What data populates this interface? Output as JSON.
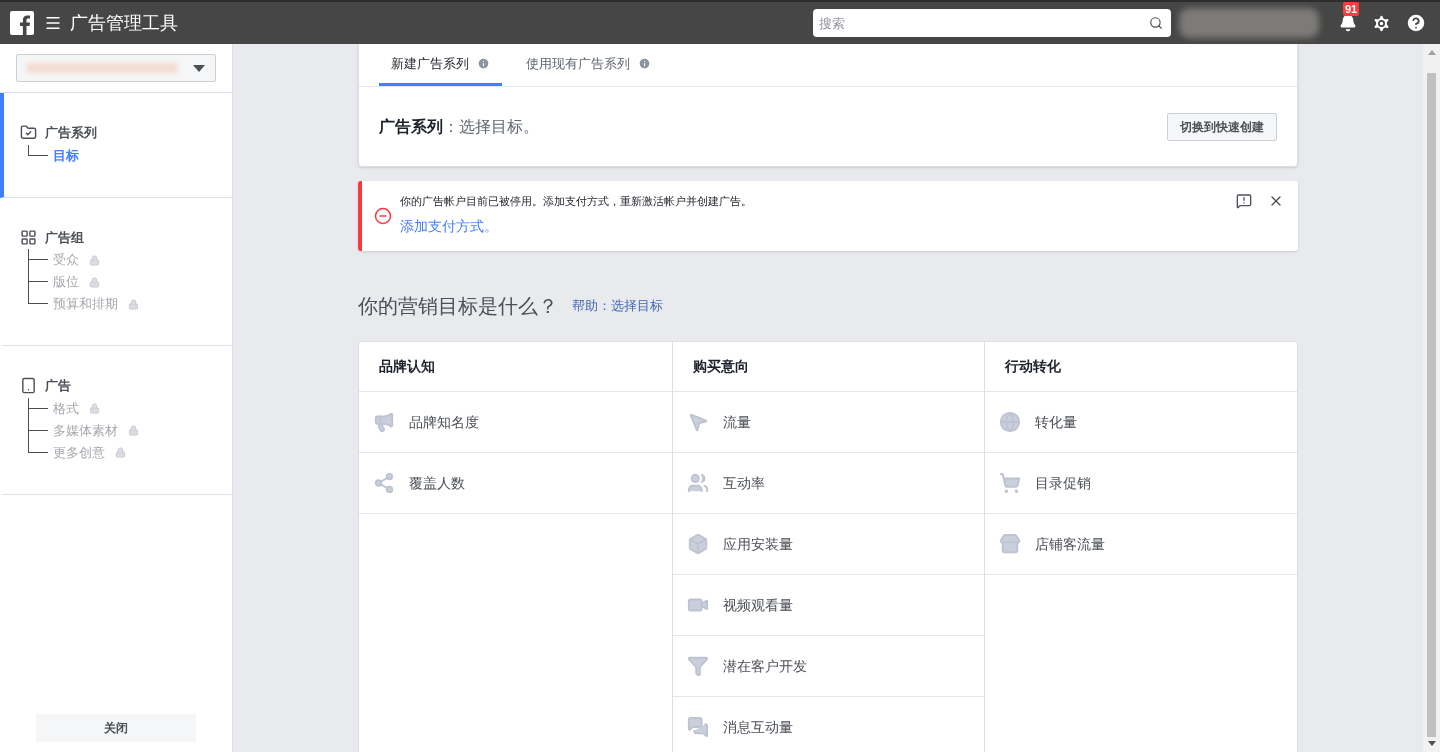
{
  "header": {
    "title": "广告管理工具",
    "search": {
      "placeholder": "搜索"
    },
    "notification_count": "91"
  },
  "sidebar": {
    "sections": [
      {
        "title": "广告系列",
        "selected": true,
        "items": [
          {
            "label": "目标",
            "selected": true,
            "locked": false
          }
        ]
      },
      {
        "title": "广告组",
        "selected": false,
        "items": [
          {
            "label": "受众",
            "selected": false,
            "locked": true
          },
          {
            "label": "版位",
            "selected": false,
            "locked": true
          },
          {
            "label": "预算和排期",
            "selected": false,
            "locked": true
          }
        ]
      },
      {
        "title": "广告",
        "selected": false,
        "items": [
          {
            "label": "格式",
            "selected": false,
            "locked": true
          },
          {
            "label": "多媒体素材",
            "selected": false,
            "locked": true
          },
          {
            "label": "更多创意",
            "selected": false,
            "locked": true
          }
        ]
      }
    ],
    "close_button": "关闭"
  },
  "tabs": [
    {
      "label": "新建广告系列",
      "selected": true
    },
    {
      "label": "使用现有广告系列",
      "selected": false
    }
  ],
  "campaign_heading": {
    "label": "广告系列",
    "separator": "：",
    "text": "选择目标。"
  },
  "quick_create_button": "切换到快速创建",
  "alert": {
    "message": "你的广告帐户目前已被停用。添加支付方式，重新激活帐户并创建广告。",
    "link": "添加支付方式。"
  },
  "objective_heading": "你的营销目标是什么？",
  "help_link": "帮助：选择目标",
  "objective_columns": [
    {
      "title": "品牌认知",
      "items": [
        "品牌知名度",
        "覆盖人数"
      ]
    },
    {
      "title": "购买意向",
      "items": [
        "流量",
        "互动率",
        "应用安装量",
        "视频观看量",
        "潜在客户开发",
        "消息互动量"
      ]
    },
    {
      "title": "行动转化",
      "items": [
        "转化量",
        "目录促销",
        "店铺客流量"
      ]
    }
  ]
}
